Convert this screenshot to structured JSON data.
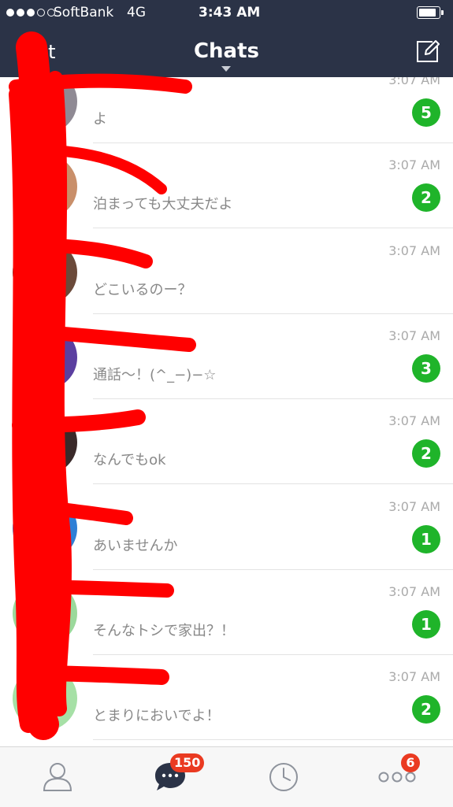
{
  "status_bar": {
    "carrier": "SoftBank",
    "network": "4G",
    "time": "3:43 AM",
    "signal_bars_filled": 3,
    "signal_bars_total": 5
  },
  "nav": {
    "edit_label": "Edit",
    "title": "Chats"
  },
  "chats": [
    {
      "name": "",
      "message": "よ",
      "time": "3:07 AM",
      "unread": "5",
      "avatar_color": "#8f8a94"
    },
    {
      "name": "",
      "message": "泊まっても大丈夫だよ",
      "time": "3:07 AM",
      "unread": "2",
      "avatar_color": "#c98f6a"
    },
    {
      "name": "",
      "message": "どこいるのー？",
      "time": "3:07 AM",
      "unread": "",
      "avatar_color": "#6b4a3a"
    },
    {
      "name": "",
      "message": "通話〜！(^_−)−☆",
      "time": "3:07 AM",
      "unread": "3",
      "avatar_color": "#5b3fa0"
    },
    {
      "name": "",
      "message": "なんでもok",
      "time": "3:07 AM",
      "unread": "2",
      "avatar_color": "#3a2a2a"
    },
    {
      "name": "",
      "message": "あいませんか",
      "time": "3:07 AM",
      "unread": "1",
      "avatar_color": "#2f7fd6"
    },
    {
      "name": "",
      "message": "そんなトシで家出？！",
      "time": "3:07 AM",
      "unread": "1",
      "avatar_color": "#9bd99b"
    },
    {
      "name": "",
      "message": "とまりにおいでよ！",
      "time": "3:07 AM",
      "unread": "2",
      "avatar_color": "#a6e0a6"
    }
  ],
  "tab_bar": {
    "friends_icon": "person-icon",
    "chats_icon": "chat-bubble-icon",
    "chats_badge": "150",
    "timeline_icon": "clock-icon",
    "more_icon": "more-icon",
    "more_badge": "6"
  },
  "colors": {
    "header_bg": "#2b3347",
    "badge_green": "#1fb42a",
    "badge_red": "#ea3a21",
    "scribble_red": "#ff0000"
  }
}
